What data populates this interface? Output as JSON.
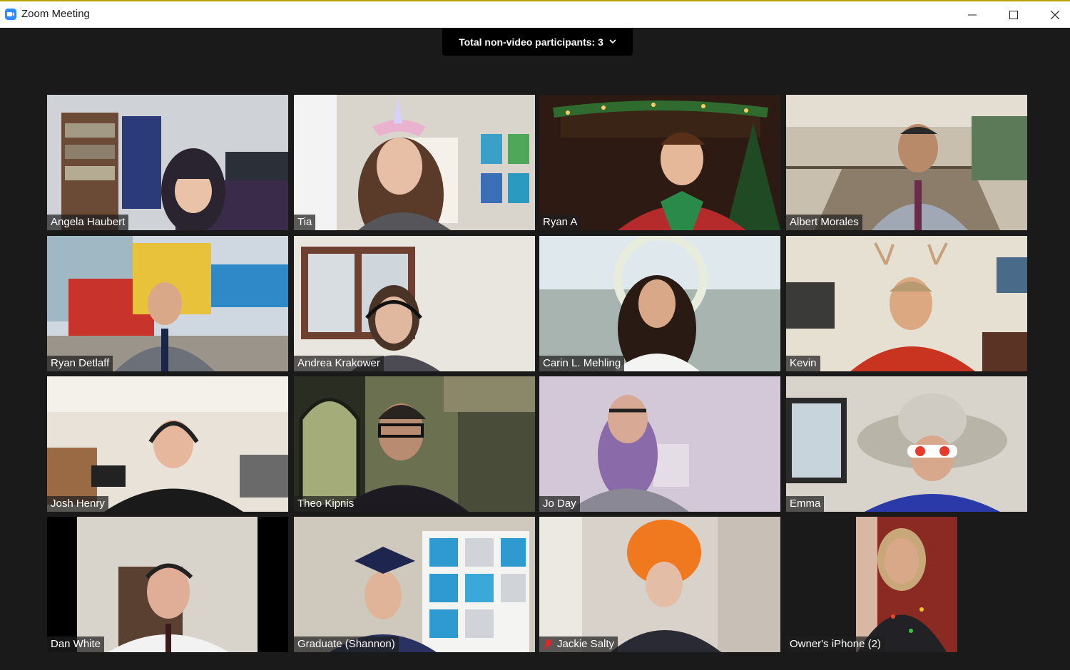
{
  "window": {
    "title": "Zoom Meeting",
    "accent_color": "#2d8cff",
    "controls": [
      "minimize-icon",
      "maximize-icon",
      "close-icon"
    ]
  },
  "banner": {
    "label": "Total non-video participants: 3",
    "icon": "chevron-down-icon"
  },
  "participants": [
    {
      "name": "Angela Haubert"
    },
    {
      "name": "Tia"
    },
    {
      "name": "Ryan A"
    },
    {
      "name": "Albert Morales"
    },
    {
      "name": "Ryan Detlaff"
    },
    {
      "name": "Andrea Krakower"
    },
    {
      "name": "Carin L. Mehling"
    },
    {
      "name": "Kevin"
    },
    {
      "name": "Josh Henry"
    },
    {
      "name": "Theo Kipnis"
    },
    {
      "name": "Jo Day"
    },
    {
      "name": "Emma"
    },
    {
      "name": "Dan White"
    },
    {
      "name": "Graduate (Shannon)"
    },
    {
      "name": "Jackie Salty",
      "muted": true,
      "muted_icon": "microphone-muted-icon"
    },
    {
      "name": "Owner's iPhone (2)"
    }
  ]
}
